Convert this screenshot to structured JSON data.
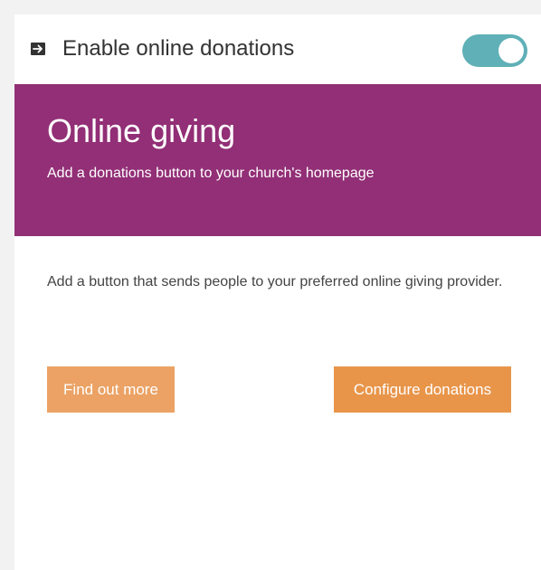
{
  "toggle": {
    "icon": "arrow-right-icon",
    "label": "Enable online donations",
    "enabled": true,
    "color": "#5fb0b7"
  },
  "banner": {
    "title": "Online giving",
    "subtitle": "Add a donations button to your church's homepage",
    "background": "#922f76"
  },
  "content": {
    "description": "Add a button that sends people to your preferred online giving provider."
  },
  "actions": {
    "find_out_more_label": "Find out more",
    "configure_label": "Configure donations",
    "button_color": "#e8954a"
  }
}
